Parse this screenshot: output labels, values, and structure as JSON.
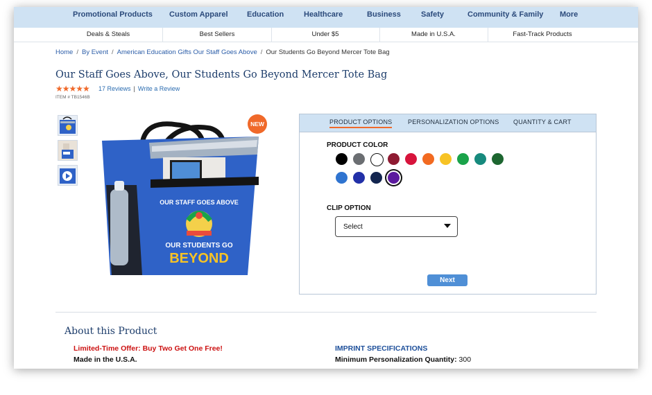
{
  "topnav": {
    "items": [
      "Promotional Products",
      "Custom Apparel",
      "Education",
      "Healthcare",
      "Business",
      "Safety",
      "Community & Family",
      "More"
    ]
  },
  "subnav": {
    "items": [
      "Deals & Steals",
      "Best Sellers",
      "Under $5",
      "Made in U.S.A.",
      "Fast-Track Products"
    ]
  },
  "breadcrumb": {
    "items": [
      "Home",
      "By Event",
      "American Education Gifts Our Staff Goes Above"
    ],
    "current": "Our Students Go Beyond Mercer Tote Bag"
  },
  "product": {
    "title": "Our Staff Goes Above, Our Students Go Beyond Mercer Tote Bag",
    "stars": "★★★★★",
    "rating": 5,
    "reviews_label": "17 Reviews",
    "write_review_label": "Write a Review",
    "item_number": "ITEM # TB1546B",
    "badge": "NEW",
    "print_line1": "OUR STAFF GOES ABOVE",
    "print_line2": "OUR STUDENTS GO",
    "print_line3": "BEYOND"
  },
  "options": {
    "tabs": [
      "PRODUCT OPTIONS",
      "PERSONALIZATION OPTIONS",
      "QUANTITY & CART"
    ],
    "active_tab": 0,
    "color_label": "PRODUCT COLOR",
    "colors": [
      "#000000",
      "#6b6e72",
      "#ffffff",
      "#8e1b32",
      "#d7143c",
      "#f26a21",
      "#f7c325",
      "#1aa34a",
      "#178a7d",
      "#1d6630",
      "#2f74d0",
      "#2230a8",
      "#13254f",
      "#5b1a9e"
    ],
    "selected_color_index": 13,
    "clip_label": "CLIP OPTION",
    "clip_value": "Select",
    "next_label": "Next"
  },
  "about": {
    "heading": "About this Product",
    "offer": "Limited-Time Offer: Buy Two Get One Free!",
    "made": "Made in the U.S.A.",
    "imprint_heading": "IMPRINT SPECIFICATIONS",
    "min_qty_label": "Minimum Personalization Quantity:",
    "min_qty_value": "300"
  }
}
